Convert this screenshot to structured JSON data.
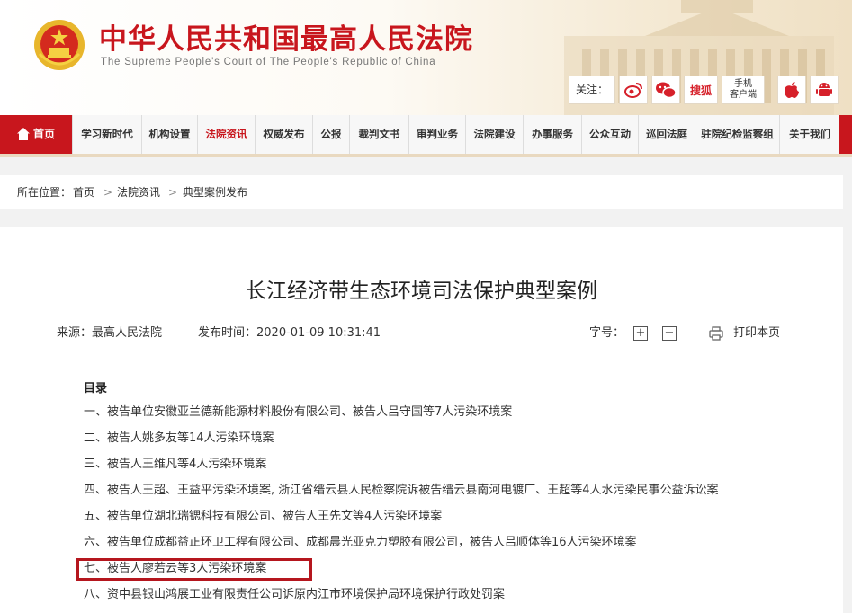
{
  "header": {
    "title": "中华人民共和国最高人民法院",
    "subtitle": "The Supreme People's Court of The People's Republic of China",
    "follow_label": "关注：",
    "social": [
      {
        "icon": "weibo-icon"
      },
      {
        "icon": "wechat-icon"
      },
      {
        "label": "搜狐"
      },
      {
        "label": "手机\n客户端"
      },
      {
        "icon": "apple-icon"
      },
      {
        "icon": "android-icon"
      }
    ],
    "mobile_line1": "手机",
    "mobile_line2": "客户端",
    "sohu": "搜狐"
  },
  "nav": {
    "home": "首页",
    "items": [
      "学习新时代",
      "机构设置",
      "法院资讯",
      "权威发布",
      "公报",
      "裁判文书",
      "审判业务",
      "法院建设",
      "办事服务",
      "公众互动",
      "巡回法庭",
      "驻院纪检监察组",
      "关于我们"
    ],
    "active_index": 2
  },
  "breadcrumb": {
    "prefix": "所在位置：",
    "items": [
      "首页",
      "法院资讯",
      "典型案例发布"
    ],
    "sep": ">"
  },
  "article": {
    "title": "长江经济带生态环境司法保护典型案例",
    "source": "来源：最高人民法院",
    "published": "发布时间：2020-01-09 10:31:41",
    "font_label": "字号：",
    "font_plus": "+",
    "font_minus": "−",
    "print": "打印本页",
    "toc_title": "目录",
    "toc": [
      "一、被告单位安徽亚兰德新能源材料股份有限公司、被告人吕守国等7人污染环境案",
      "二、被告人姚多友等14人污染环境案",
      "三、被告人王维凡等4人污染环境案",
      "四、被告人王超、王益平污染环境案, 浙江省缙云县人民检察院诉被告缙云县南河电镀厂、王超等4人水污染民事公益诉讼案",
      "五、被告单位湖北瑞锶科技有限公司、被告人王先文等4人污染环境案",
      "六、被告单位成都益正环卫工程有限公司、成都晨光亚克力塑胶有限公司，被告人吕顺体等16人污染环境案",
      "七、被告人廖若云等3人污染环境案",
      "八、资中县银山鸿展工业有限责任公司诉原内江市环境保护局环境保护行政处罚案"
    ],
    "highlighted_index": 6,
    "highlight_color": "#b5161e"
  },
  "colors": {
    "brand_red": "#c8161d",
    "nav_bg": "#f7f7f7"
  }
}
